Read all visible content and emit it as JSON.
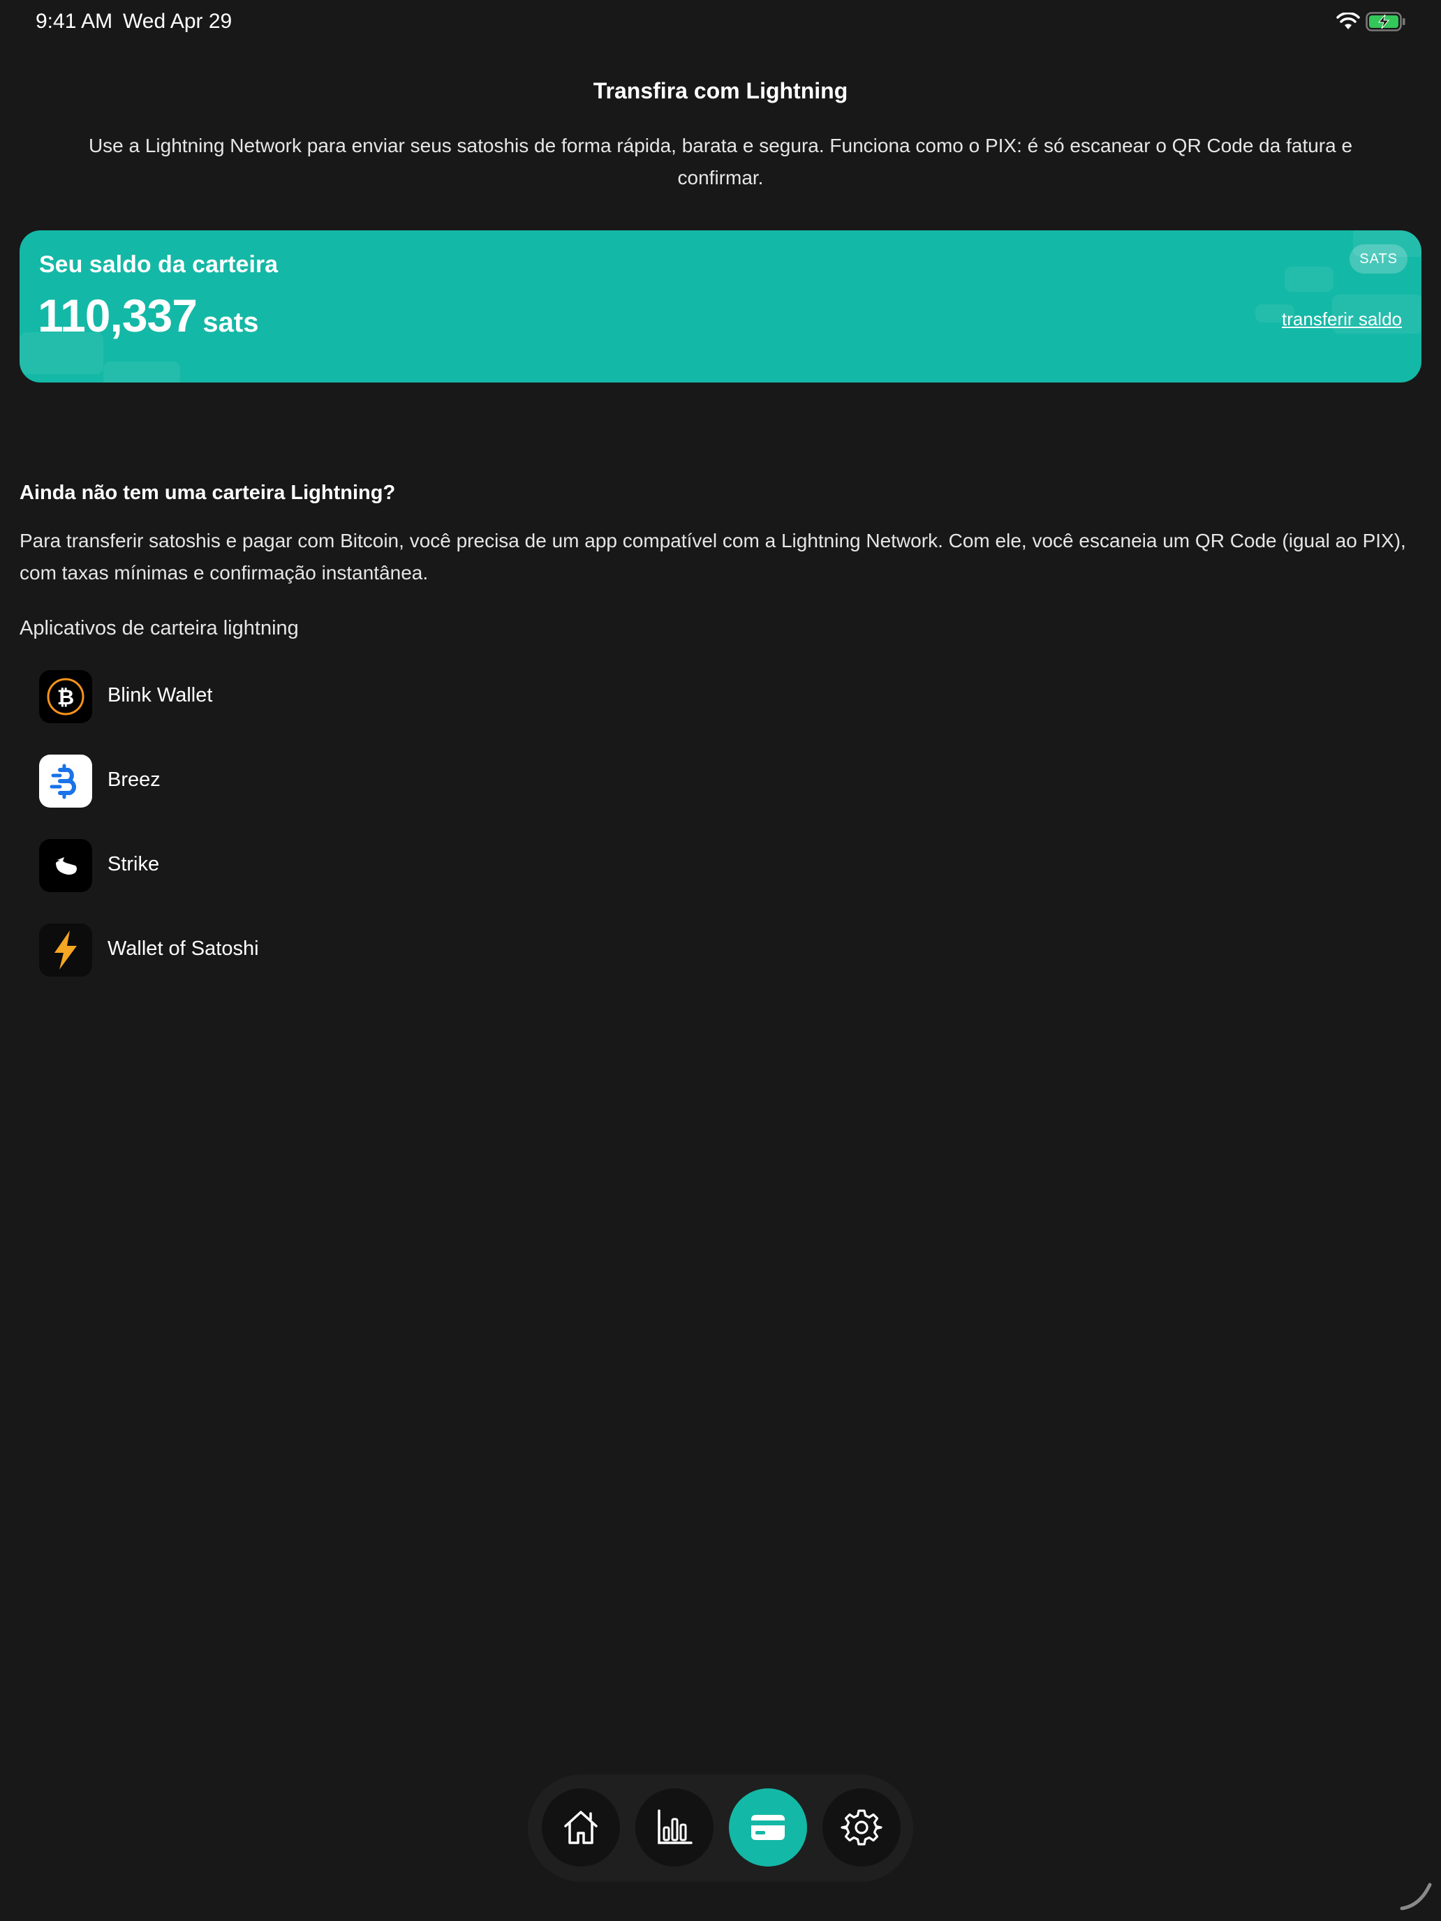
{
  "status_bar": {
    "time": "9:41 AM",
    "date": "Wed Apr 29",
    "icons": [
      "wifi-icon",
      "battery-charging-icon"
    ]
  },
  "header": {
    "title": "Transfira com Lightning",
    "subtitle": "Use a Lightning Network para enviar seus satoshis de forma rápida, barata e segura. Funciona como o PIX: é só escanear o QR Code da fatura e confirmar."
  },
  "balance_card": {
    "label": "Seu saldo da carteira",
    "amount": "110,337",
    "unit": "sats",
    "badge": "SATS",
    "transfer_link": "transferir saldo",
    "background_color": "#14b8a6"
  },
  "info": {
    "heading": "Ainda não tem uma carteira Lightning?",
    "body": "Para transferir satoshis e pagar com Bitcoin, você precisa de um app compatível com a Lightning Network. Com ele, você escaneia um QR Code (igual ao PIX), com taxas mínimas e confirmação instantânea.",
    "apps_label": "Aplicativos de carteira lightning"
  },
  "apps": [
    {
      "name": "Blink Wallet",
      "icon": "blink-bitcoin-icon"
    },
    {
      "name": "Breez",
      "icon": "breez-icon"
    },
    {
      "name": "Strike",
      "icon": "strike-icon"
    },
    {
      "name": "Wallet of Satoshi",
      "icon": "lightning-bolt-icon"
    }
  ],
  "bottom_nav": {
    "items": [
      {
        "icon": "home-icon",
        "active": false
      },
      {
        "icon": "bar-chart-icon",
        "active": false
      },
      {
        "icon": "credit-card-icon",
        "active": true
      },
      {
        "icon": "gear-icon",
        "active": false
      }
    ],
    "accent_color": "#14b8a6"
  }
}
